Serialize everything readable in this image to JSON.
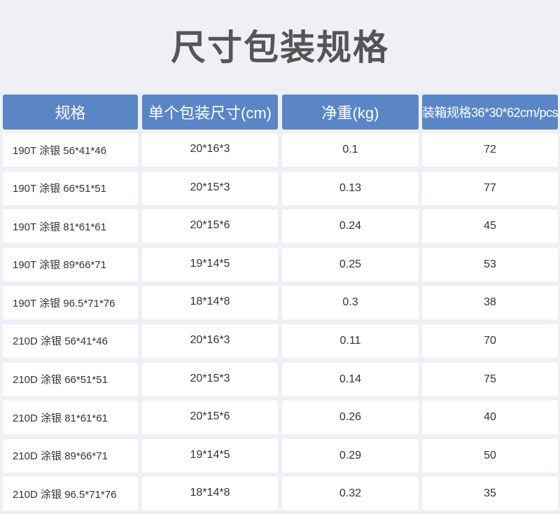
{
  "title": "尺寸包装规格",
  "table": {
    "headers": [
      "规格",
      "单个包装尺寸(cm)",
      "净重(kg)",
      "装箱规格36*30*62cm/pcs"
    ],
    "rows": [
      [
        "190T 涂银 56*41*46",
        "20*16*3",
        "0.1",
        "72"
      ],
      [
        "190T 涂银 66*51*51",
        "20*15*3",
        "0.13",
        "77"
      ],
      [
        "190T 涂银 81*61*61",
        "20*15*6",
        "0.24",
        "45"
      ],
      [
        "190T 涂银 89*66*71",
        "19*14*5",
        "0.25",
        "53"
      ],
      [
        "190T 涂银 96.5*71*76",
        "18*14*8",
        "0.3",
        "38"
      ],
      [
        "210D 涂银 56*41*46",
        "20*16*3",
        "0.11",
        "70"
      ],
      [
        "210D 涂银 66*51*51",
        "20*15*3",
        "0.14",
        "75"
      ],
      [
        "210D 涂银 81*61*61",
        "20*15*6",
        "0.26",
        "40"
      ],
      [
        "210D 涂银 89*66*71",
        "19*14*5",
        "0.29",
        "50"
      ],
      [
        "210D 涂银 96.5*71*76",
        "18*14*8",
        "0.32",
        "35"
      ]
    ]
  },
  "colors": {
    "header_bg": "#5a86c8",
    "page_bg": "#eef0f6",
    "title_text": "#555555"
  }
}
